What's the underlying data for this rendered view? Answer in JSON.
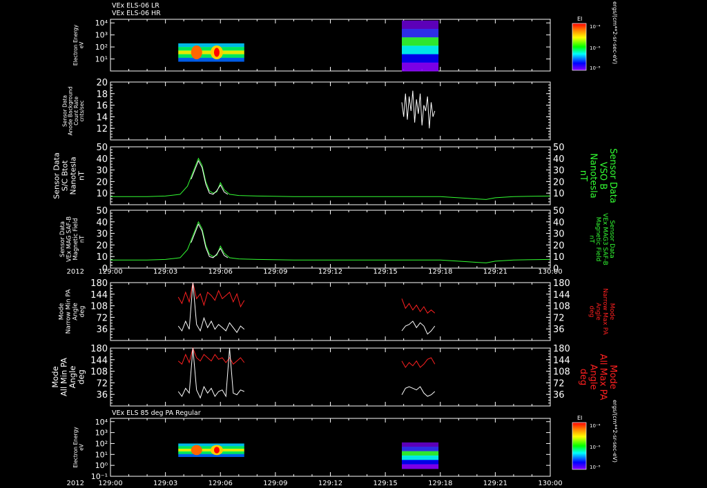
{
  "header": {
    "line1": "VEx ELS-06 LR",
    "line2": "VEx ELS-06 HR",
    "bottom_title": "VEx ELS 85 deg PA Regular"
  },
  "time_axis": {
    "year": "2012",
    "ticks": [
      "129:00",
      "129:03",
      "129:06",
      "129:09",
      "129:12",
      "129:15",
      "129:18",
      "129:21",
      "130:00"
    ]
  },
  "colorbar": {
    "label": "EI",
    "ticks": [
      "10⁻⁴",
      "10⁻⁶",
      "10⁻⁸"
    ],
    "units": "ergs/(cm**2-sr-sec-eV)",
    "colors": [
      "#ff0000",
      "#ff8800",
      "#ffff00",
      "#00ff00",
      "#00ffff",
      "#0000ff",
      "#8800ff"
    ]
  },
  "colors": {
    "background": "#000000",
    "axis": "#ffffff",
    "green": "#33ff33",
    "red": "#ff2020",
    "white": "#ffffff"
  },
  "chart_data": [
    {
      "type": "heatmap",
      "title": "VEx ELS-06 LR / VEx ELS-06 HR",
      "ylabel": [
        "Electron Energy",
        "eV"
      ],
      "yticks": [
        "10⁴",
        "10³",
        "10²",
        "10¹"
      ],
      "ylim_log10": [
        0,
        4.3
      ],
      "scale": "log",
      "blocks": [
        {
          "t_start": 3.7,
          "t_end": 7.3,
          "e_min_log10": 0.8,
          "e_max_log10": 2.3
        },
        {
          "t_start": 15.9,
          "t_end": 17.9,
          "e_min_log10": 0.0,
          "e_max_log10": 4.2
        }
      ]
    },
    {
      "type": "line",
      "ylabel": [
        "Sensor Data",
        "Anode Background",
        "Count Rate",
        "cnts/sec"
      ],
      "ylim": [
        10,
        20
      ],
      "yticks": [
        "20",
        "18",
        "16",
        "14",
        "12"
      ],
      "series": [
        {
          "color": "white",
          "x": [
            15.9,
            16.0,
            16.1,
            16.2,
            16.3,
            16.4,
            16.5,
            16.6,
            16.7,
            16.8,
            16.9,
            17.0,
            17.1,
            17.2,
            17.3,
            17.4,
            17.5,
            17.6,
            17.7
          ],
          "y": [
            16.5,
            14,
            18,
            13.5,
            17.5,
            15,
            18.5,
            13,
            17,
            14.5,
            18,
            12.5,
            16,
            15,
            17.5,
            12,
            16.5,
            14,
            15
          ]
        }
      ]
    },
    {
      "type": "line",
      "ylabel": [
        "Sensor Data",
        "S/C Btot",
        "Nanotesla",
        "nT"
      ],
      "ylabel_right": [
        "Sensor Data",
        "VSO B",
        "Nanotesla",
        "nT"
      ],
      "ylim": [
        0,
        50
      ],
      "yticks": [
        "50",
        "40",
        "30",
        "20",
        "10"
      ],
      "series": [
        {
          "name": "VSO B",
          "color": "green",
          "x": [
            0,
            1,
            2,
            3,
            3.8,
            4.2,
            4.4,
            4.6,
            4.8,
            5.0,
            5.2,
            5.4,
            5.6,
            5.8,
            6.0,
            6.2,
            6.5,
            7,
            8,
            10,
            12,
            14,
            16,
            18,
            19.5,
            20,
            20.5,
            21,
            22,
            24
          ],
          "y": [
            7,
            7,
            7,
            7.5,
            9,
            16,
            24,
            32,
            40,
            34,
            20,
            12,
            10,
            11,
            19,
            13,
            9,
            8,
            7.5,
            7,
            7,
            7,
            7,
            7,
            5.5,
            5,
            4.5,
            6,
            7,
            7.5
          ]
        },
        {
          "color": "white",
          "x": [
            4.4,
            4.6,
            4.8,
            5.0,
            5.2,
            5.4,
            5.6,
            5.8,
            6.0,
            6.2,
            6.4
          ],
          "y": [
            22,
            30,
            38,
            32,
            18,
            10,
            9,
            12,
            17,
            11,
            9
          ]
        }
      ]
    },
    {
      "type": "line",
      "ylabel": [
        "Sensor Data",
        "VEx MAG SAF-B",
        "Magnetic Field",
        "nT"
      ],
      "ylabel_right": [
        "Sensor Data",
        "VEx MAG3 SAF-B",
        "Magnetic Field",
        "nT"
      ],
      "ylim": [
        0,
        50
      ],
      "yticks": [
        "50",
        "40",
        "30",
        "20",
        "10",
        "0"
      ],
      "series": [
        {
          "name": "VEx MAG3 SAF-B",
          "color": "green",
          "x": [
            0,
            1,
            2,
            3,
            3.8,
            4.2,
            4.4,
            4.6,
            4.8,
            5.0,
            5.2,
            5.4,
            5.6,
            5.8,
            6.0,
            6.2,
            6.5,
            7,
            8,
            10,
            12,
            14,
            16,
            18,
            19.5,
            20,
            20.5,
            21,
            22,
            24
          ],
          "y": [
            7,
            7,
            7,
            7.5,
            9,
            16,
            24,
            32,
            40,
            34,
            20,
            12,
            10,
            11,
            19,
            13,
            9,
            8,
            7.5,
            7,
            7,
            7,
            7,
            7,
            5.5,
            5,
            4.5,
            6,
            7,
            7.5
          ]
        },
        {
          "color": "white",
          "x": [
            4.4,
            4.6,
            4.8,
            5.0,
            5.2,
            5.4,
            5.6,
            5.8,
            6.0,
            6.2,
            6.4
          ],
          "y": [
            22,
            30,
            38,
            32,
            18,
            10,
            9,
            12,
            17,
            11,
            9
          ]
        }
      ]
    },
    {
      "type": "line",
      "ylabel": [
        "Mode",
        "Narrow Min PA",
        "Angle",
        "deg"
      ],
      "ylabel_right": [
        "Mode",
        "Narrow Max PA",
        "Angle",
        "deg"
      ],
      "ylim": [
        0,
        180
      ],
      "yticks": [
        "180",
        "144",
        "108",
        "72",
        "36"
      ],
      "series": [
        {
          "name": "Narrow Max PA",
          "color": "red",
          "x": [
            3.7,
            3.9,
            4.1,
            4.3,
            4.5,
            4.7,
            4.9,
            5.1,
            5.3,
            5.5,
            5.7,
            5.9,
            6.1,
            6.3,
            6.5,
            6.7,
            6.9,
            7.1,
            7.3,
            15.9,
            16.1,
            16.3,
            16.5,
            16.7,
            16.9,
            17.1,
            17.3,
            17.5,
            17.7
          ],
          "y": [
            135,
            115,
            150,
            120,
            180,
            130,
            145,
            110,
            150,
            140,
            125,
            155,
            130,
            140,
            150,
            120,
            145,
            105,
            125,
            130,
            100,
            115,
            95,
            110,
            90,
            105,
            85,
            95,
            85
          ]
        },
        {
          "name": "Narrow Min PA",
          "color": "white",
          "x": [
            3.7,
            3.9,
            4.1,
            4.3,
            4.5,
            4.7,
            4.9,
            5.1,
            5.3,
            5.5,
            5.7,
            5.9,
            6.1,
            6.3,
            6.5,
            6.7,
            6.9,
            7.1,
            7.3,
            15.9,
            16.1,
            16.3,
            16.5,
            16.7,
            16.9,
            17.1,
            17.3,
            17.5,
            17.7
          ],
          "y": [
            45,
            30,
            60,
            35,
            180,
            50,
            30,
            70,
            40,
            60,
            35,
            50,
            40,
            30,
            55,
            40,
            25,
            45,
            35,
            30,
            45,
            50,
            60,
            40,
            55,
            45,
            20,
            30,
            45
          ]
        }
      ]
    },
    {
      "type": "line",
      "ylabel": [
        "Mode",
        "All Min PA",
        "Angle",
        "deg"
      ],
      "ylabel_right": [
        "Mode",
        "All Max PA",
        "Angle",
        "deg"
      ],
      "ylim": [
        0,
        180
      ],
      "yticks": [
        "180",
        "144",
        "108",
        "72",
        "36"
      ],
      "series": [
        {
          "name": "All Max PA",
          "color": "red",
          "x": [
            3.7,
            3.9,
            4.1,
            4.3,
            4.5,
            4.7,
            4.9,
            5.1,
            5.3,
            5.5,
            5.7,
            5.9,
            6.1,
            6.3,
            6.5,
            6.7,
            6.9,
            7.1,
            7.3,
            15.9,
            16.1,
            16.3,
            16.5,
            16.7,
            16.9,
            17.1,
            17.3,
            17.5,
            17.7
          ],
          "y": [
            140,
            130,
            160,
            135,
            180,
            150,
            140,
            160,
            150,
            140,
            160,
            145,
            150,
            135,
            150,
            130,
            140,
            150,
            135,
            140,
            120,
            135,
            125,
            140,
            120,
            130,
            145,
            150,
            130
          ]
        },
        {
          "name": "All Min PA",
          "color": "white",
          "x": [
            3.7,
            3.9,
            4.1,
            4.3,
            4.5,
            4.7,
            4.9,
            5.1,
            5.3,
            5.5,
            5.7,
            5.9,
            6.1,
            6.3,
            6.5,
            6.7,
            6.9,
            7.1,
            7.3,
            15.9,
            16.1,
            16.3,
            16.5,
            16.7,
            16.9,
            17.1,
            17.3,
            17.5,
            17.7
          ],
          "y": [
            45,
            30,
            55,
            40,
            180,
            50,
            25,
            60,
            40,
            55,
            30,
            45,
            50,
            30,
            180,
            40,
            35,
            50,
            45,
            35,
            55,
            60,
            55,
            50,
            60,
            40,
            30,
            35,
            45
          ]
        }
      ]
    },
    {
      "type": "heatmap",
      "title": "VEx ELS 85 deg PA Regular",
      "ylabel": [
        "Electron Energy",
        "eV"
      ],
      "yticks": [
        "10⁴",
        "10³",
        "10²",
        "10¹",
        "10⁰",
        "10⁻¹"
      ],
      "ylim_log10": [
        -1,
        4.3
      ],
      "scale": "log",
      "blocks": [
        {
          "t_start": 3.7,
          "t_end": 7.3,
          "e_min_log10": 0.8,
          "e_max_log10": 2.0
        },
        {
          "t_start": 15.9,
          "t_end": 17.9,
          "e_min_log10": -0.3,
          "e_max_log10": 2.1
        }
      ]
    }
  ]
}
